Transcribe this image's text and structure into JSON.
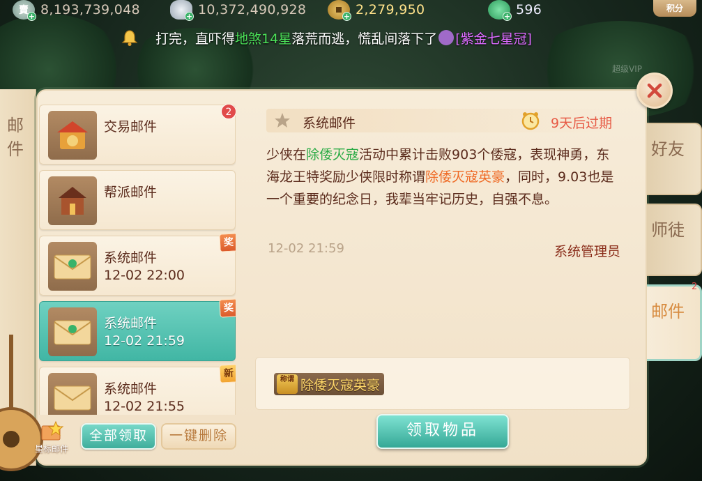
{
  "currencies": [
    {
      "icon": "gold-token-icon",
      "value": "8,193,739,048"
    },
    {
      "icon": "silver-ingot-icon",
      "value": "10,372,490,928"
    },
    {
      "icon": "copper-coin-icon",
      "value": "2,279,950"
    },
    {
      "icon": "jade-icon",
      "value": "596"
    }
  ],
  "score_button": "积分",
  "ticker": {
    "part1": "　打完，直吓得",
    "name": "地煞14星",
    "part2": "落荒而逃，慌乱间落下了",
    "item": "[紫金七星冠]"
  },
  "faint_label": "超级VIP",
  "left_rail_label": "邮件",
  "star_mail_label": "星标邮件",
  "mail_list": [
    {
      "title": "交易邮件",
      "time": "",
      "badge": "2",
      "icon": "trade-mail-icon"
    },
    {
      "title": "帮派邮件",
      "time": "",
      "badge": "",
      "icon": "guild-mail-icon"
    },
    {
      "title": "系统邮件",
      "time": "12-02 22:00",
      "badge": "奖",
      "icon": "envelope-icon"
    },
    {
      "title": "系统邮件",
      "time": "12-02 21:59",
      "badge": "奖",
      "icon": "envelope-icon",
      "selected": true
    },
    {
      "title": "系统邮件",
      "time": "12-02 21:55",
      "badge": "新",
      "icon": "envelope-icon"
    }
  ],
  "buttons": {
    "collect_all": "全部领取",
    "delete_all": "一键删除",
    "claim": "领取物品"
  },
  "detail": {
    "title": "系统邮件",
    "expire": "9天后过期",
    "body_1": "少侠在",
    "body_hl1": "除倭灭寇",
    "body_2": "活动中累计击败903个倭寇，表现神勇，东海龙王特奖励少侠限时称谓",
    "body_hl2": "除倭灭寇英豪",
    "body_3": "，同时，9.03也是一个重要的纪念日，我辈当牢记历史，自强不息。",
    "time": "12-02 21:59",
    "sender": "系统管理员",
    "attachment_tag": "称谓",
    "attachment_name": "除倭灭寇英豪"
  },
  "right_tabs": [
    {
      "label": "好友"
    },
    {
      "label": "师徒"
    },
    {
      "label": "邮件",
      "active": true
    }
  ],
  "side_badge": "2",
  "colors": {
    "accent_teal": "#41b6a4",
    "highlight_green": "#2bab46",
    "highlight_orange": "#ef6a25",
    "expire_red": "#e75a45",
    "ticker_green": "#4be058",
    "ticker_purple": "#dc6bff"
  }
}
